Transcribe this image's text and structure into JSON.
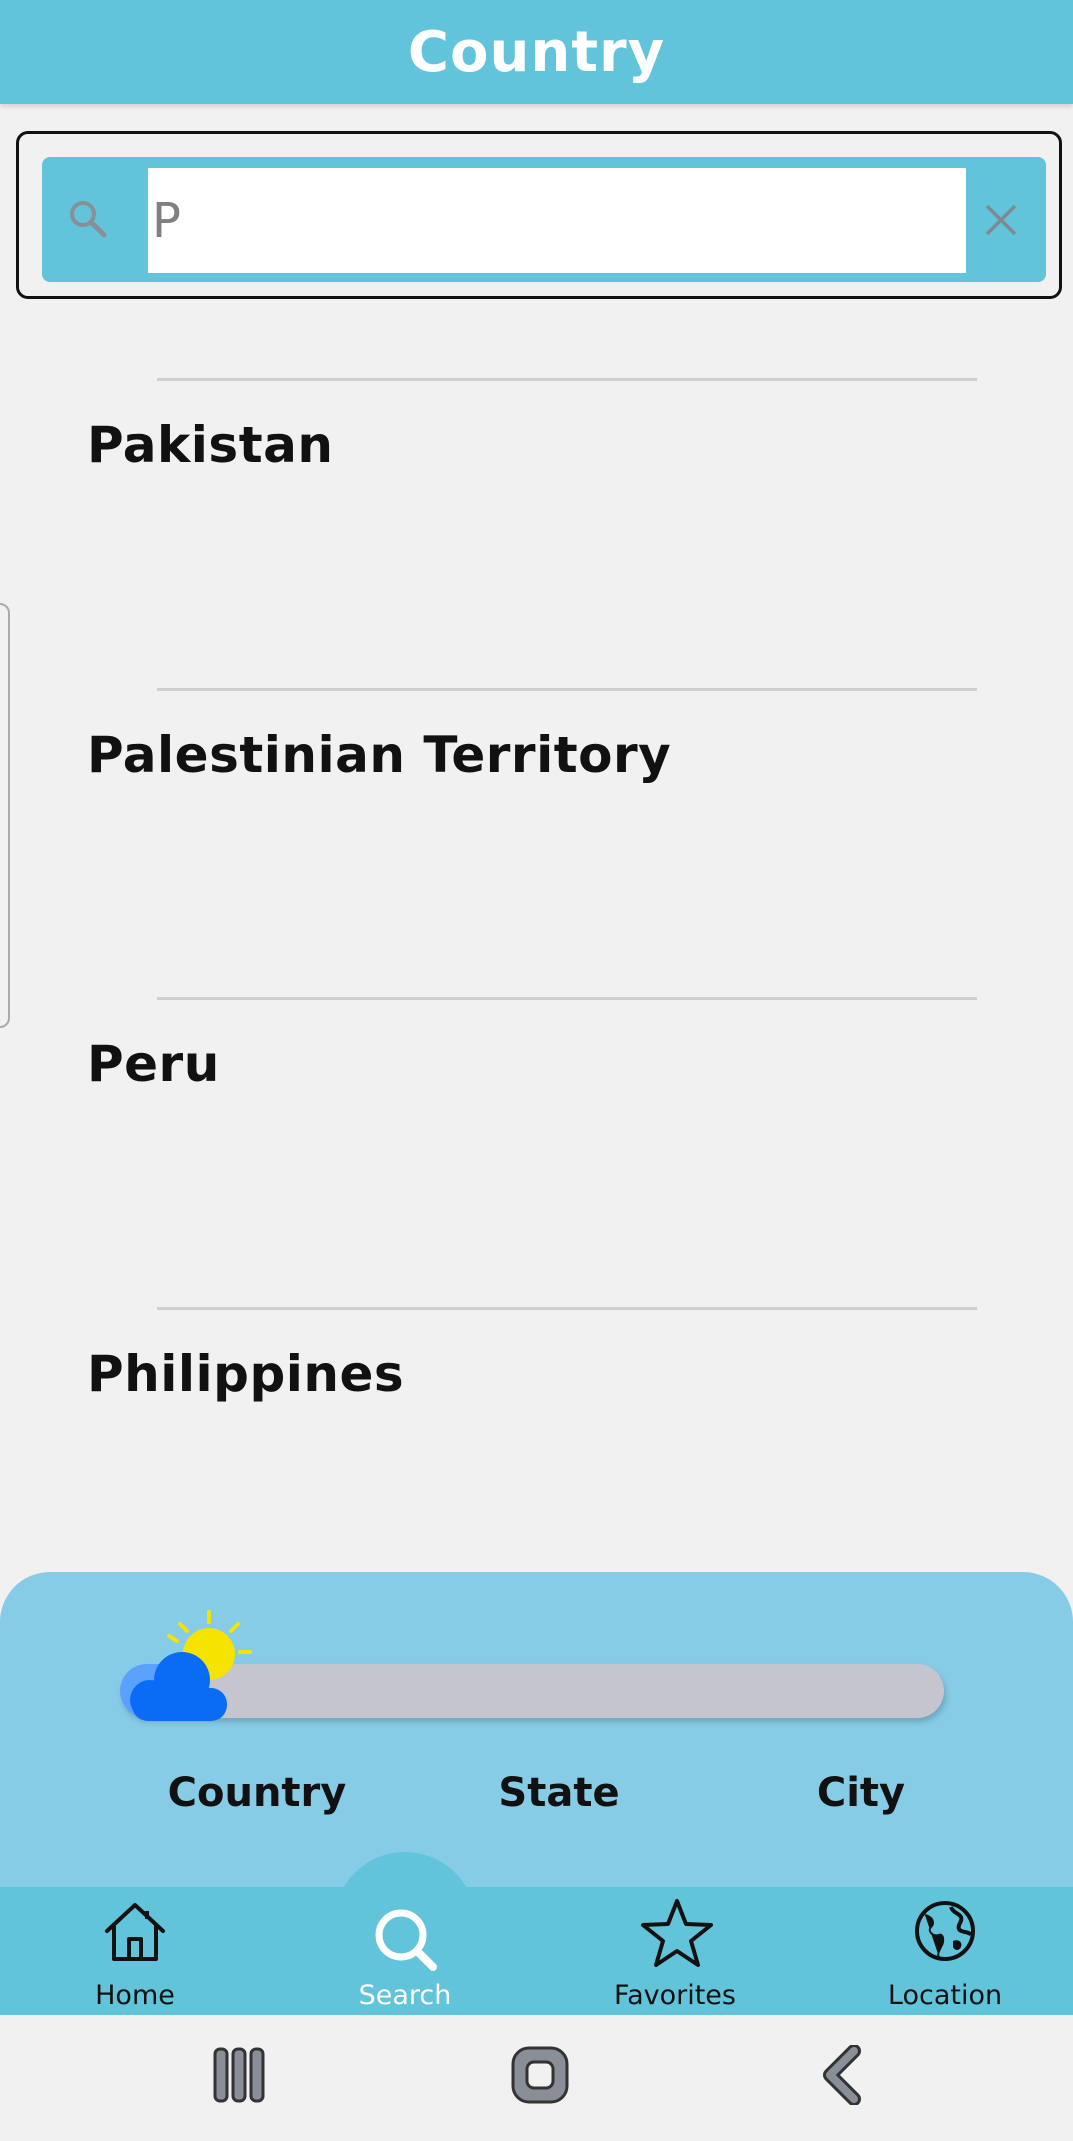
{
  "header": {
    "title": "Country"
  },
  "search": {
    "value": "P",
    "search_icon": "search-icon",
    "clear_icon": "close-icon"
  },
  "countries": [
    "Pakistan",
    "Palestinian Territory",
    "Peru",
    "Philippines"
  ],
  "progress": {
    "icon": "partly-cloudy-icon",
    "value": 0.1,
    "steps": [
      "Country",
      "State",
      "City"
    ]
  },
  "nav": {
    "items": [
      {
        "label": "Home",
        "icon": "home-icon"
      },
      {
        "label": "Search",
        "icon": "search-icon",
        "active": true
      },
      {
        "label": "Favorites",
        "icon": "star-icon"
      },
      {
        "label": "Location",
        "icon": "globe-icon"
      }
    ]
  },
  "system_nav": [
    "recent-apps-icon",
    "home-button-icon",
    "back-icon"
  ],
  "colors": {
    "primary": "#62c4da",
    "panel": "#86cce6",
    "background": "#f1f1f1",
    "progress_track": "#c4c5ce",
    "progress_fill": "#5aa0ff",
    "cloud": "#0a6cf5",
    "sun": "#f5e400"
  }
}
